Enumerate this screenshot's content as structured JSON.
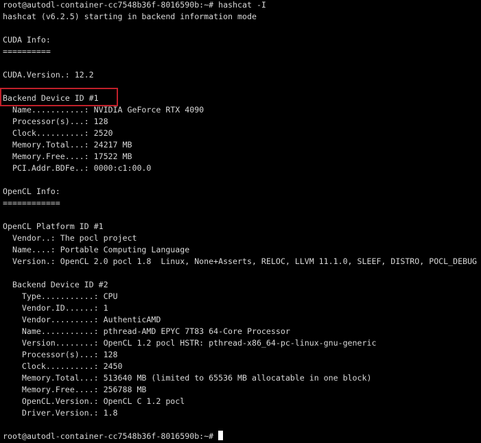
{
  "terminal": {
    "lines": [
      "root@autodl-container-cc7548b36f-8016590b:~# hashcat -I",
      "hashcat (v6.2.5) starting in backend information mode",
      "",
      "CUDA Info:",
      "==========",
      "",
      "CUDA.Version.: 12.2",
      "",
      "Backend Device ID #1",
      "  Name...........: NVIDIA GeForce RTX 4090",
      "  Processor(s)...: 128",
      "  Clock..........: 2520",
      "  Memory.Total...: 24217 MB",
      "  Memory.Free....: 17522 MB",
      "  PCI.Addr.BDFe..: 0000:c1:00.0",
      "",
      "OpenCL Info:",
      "============",
      "",
      "OpenCL Platform ID #1",
      "  Vendor..: The pocl project",
      "  Name....: Portable Computing Language",
      "  Version.: OpenCL 2.0 pocl 1.8  Linux, None+Asserts, RELOC, LLVM 11.1.0, SLEEF, DISTRO, POCL_DEBUG",
      "",
      "  Backend Device ID #2",
      "    Type...........: CPU",
      "    Vendor.ID......: 1",
      "    Vendor.........: AuthenticAMD",
      "    Name...........: pthread-AMD EPYC 7T83 64-Core Processor",
      "    Version........: OpenCL 1.2 pocl HSTR: pthread-x86_64-pc-linux-gnu-generic",
      "    Processor(s)...: 128",
      "    Clock..........: 2450",
      "    Memory.Total...: 513640 MB (limited to 65536 MB allocatable in one block)",
      "    Memory.Free....: 256788 MB",
      "    OpenCL.Version.: OpenCL C 1.2 pocl",
      "    Driver.Version.: 1.8",
      ""
    ],
    "prompt": "root@autodl-container-cc7548b36f-8016590b:~# "
  },
  "colors": {
    "background": "#000000",
    "text": "#d9d9d9",
    "highlight_border": "#c0202a",
    "cursor": "#ffffff"
  }
}
